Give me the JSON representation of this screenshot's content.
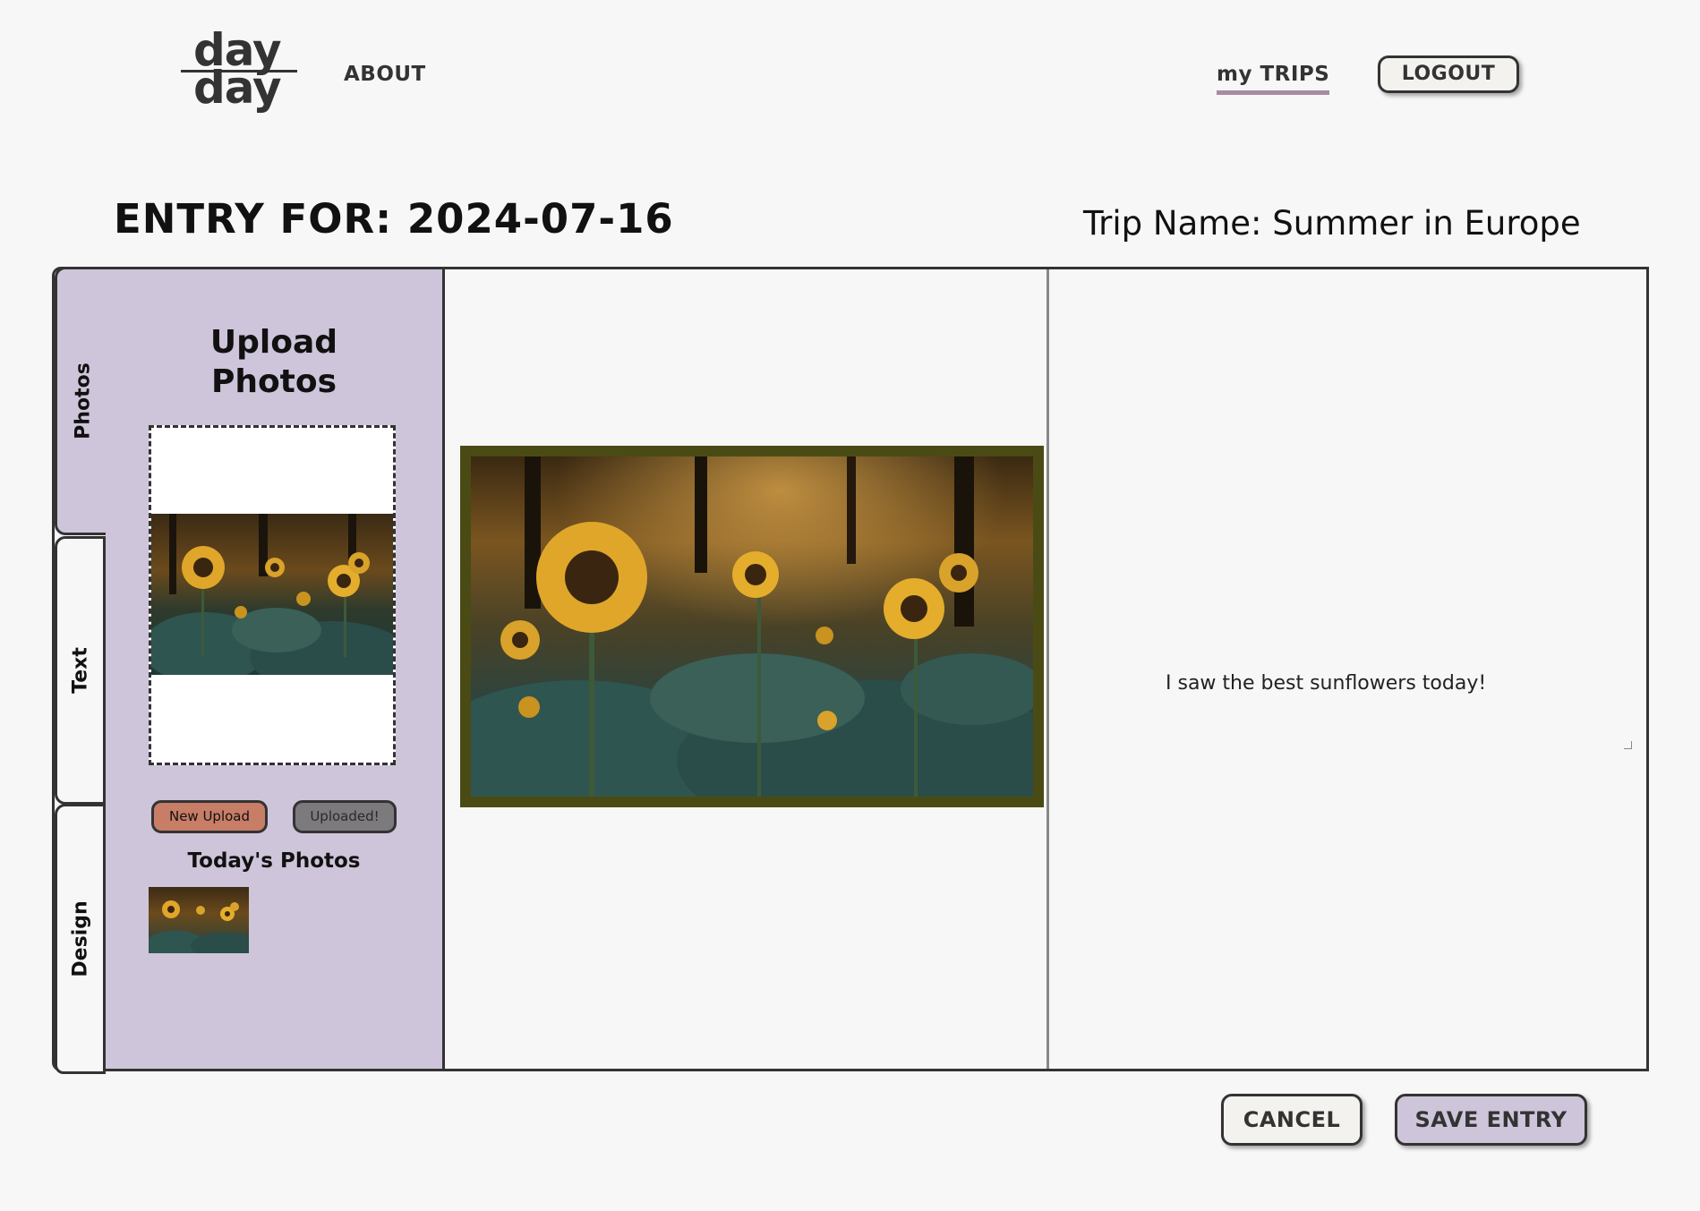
{
  "header": {
    "logo_line1": "day",
    "logo_line2": "day",
    "nav_about": "ABOUT",
    "nav_my_trips": "my TRIPS",
    "logout_label": "LOGOUT"
  },
  "entry": {
    "title": "ENTRY FOR: 2024-07-16",
    "trip_name": "Trip Name: Summer in Europe"
  },
  "tabs": [
    {
      "label": "Photos",
      "active": true
    },
    {
      "label": "Text",
      "active": false
    },
    {
      "label": "Design",
      "active": false
    }
  ],
  "photos_panel": {
    "upload_title_line1": "Upload",
    "upload_title_line2": "Photos",
    "new_upload_label": "New Upload",
    "uploaded_label": "Uploaded!",
    "todays_photos_title": "Today's Photos",
    "photo_subject": "sunflower field at sunset"
  },
  "text_panel": {
    "entry_text": "I saw the best sunflowers today!"
  },
  "footer": {
    "cancel_label": "CANCEL",
    "save_label": "SAVE ENTRY"
  },
  "colors": {
    "panel_bg": "#cec5da",
    "accent_underline": "#a88aa3",
    "new_upload_bg": "#c77d66",
    "uploaded_bg": "#7c7a7c",
    "photo_frame": "#4a4b14"
  }
}
